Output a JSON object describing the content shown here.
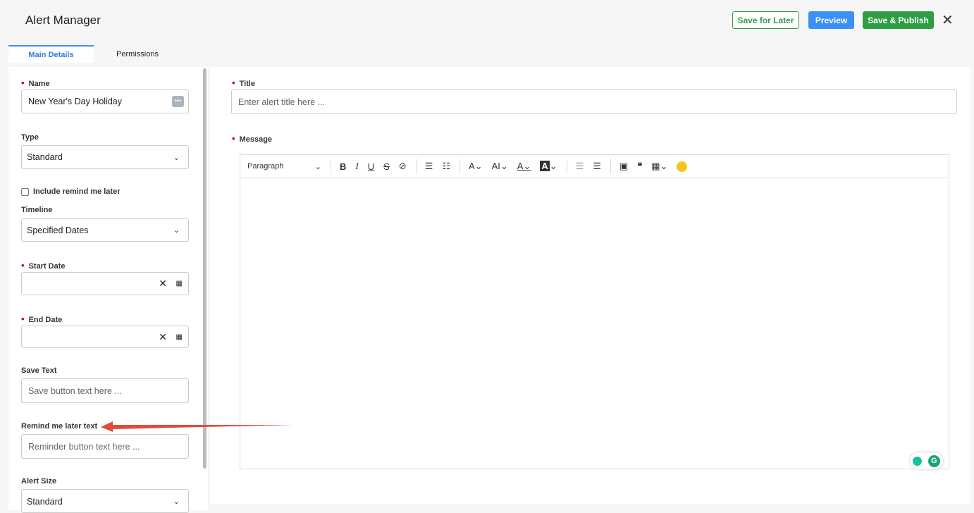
{
  "header": {
    "title": "Alert Manager",
    "save_later": "Save for Later",
    "preview": "Preview",
    "publish": "Save & Publish",
    "close": "✕"
  },
  "tabs": [
    "Main Details",
    "Permissions"
  ],
  "form": {
    "name_label": "Name",
    "name_value": "New Year's Day Holiday",
    "type_label": "Type",
    "type_value": "Standard",
    "remind_checkbox": "Include remind me later",
    "timeline_label": "Timeline",
    "timeline_value": "Specified Dates",
    "start_label": "Start Date",
    "end_label": "End Date",
    "save_text_label": "Save Text",
    "save_text_ph": "Save button text here ...",
    "remind_text_label": "Remind me later text",
    "remind_text_ph": "Reminder button text here ...",
    "size_label": "Alert Size",
    "size_value": "Standard"
  },
  "main": {
    "title_label": "Title",
    "title_ph": "Enter alert title here ...",
    "message_label": "Message",
    "paragraph": "Paragraph"
  },
  "colors": {
    "accent": "#3b8ff5",
    "green": "#2e9e45",
    "required": "#d0021b",
    "arrow": "#e04b3a"
  }
}
